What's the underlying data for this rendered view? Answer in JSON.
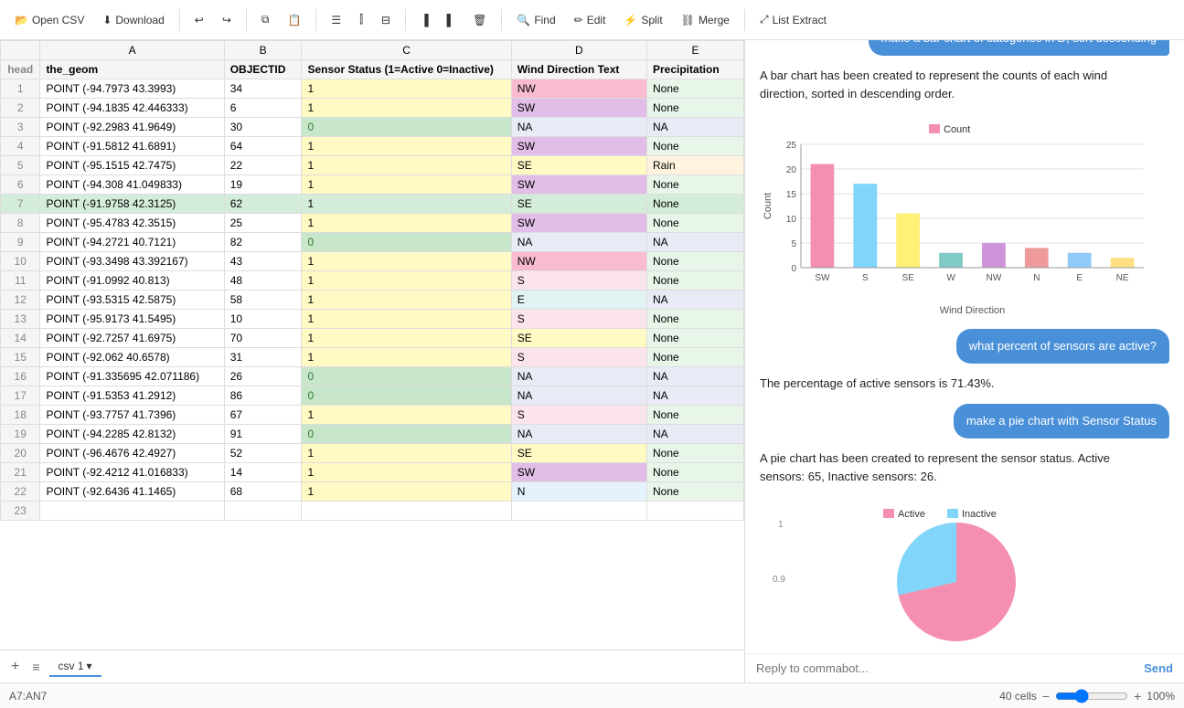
{
  "toolbar": {
    "open_csv_label": "Open CSV",
    "download_label": "Download",
    "undo_icon": "↩",
    "redo_icon": "↪",
    "copy_icon": "⧉",
    "clipboard_icon": "📋",
    "row_icon": "≡",
    "col_icon": "⫿",
    "filter_icon": "⊟",
    "freeze_left_icon": "▐",
    "freeze_right_icon": "▌",
    "delete_icon": "🗑",
    "find_label": "Find",
    "edit_label": "Edit",
    "split_label": "Split",
    "merge_label": "Merge",
    "list_extract_label": "List Extract"
  },
  "columns": [
    {
      "id": "row_num",
      "label": ""
    },
    {
      "id": "A",
      "label": "A"
    },
    {
      "id": "B",
      "label": "B"
    },
    {
      "id": "C",
      "label": "C"
    },
    {
      "id": "D",
      "label": "D"
    },
    {
      "id": "E",
      "label": "E"
    }
  ],
  "headers": {
    "head": "head",
    "col_a": "the_geom",
    "col_b": "OBJECTID",
    "col_c": "Sensor Status (1=Active 0=Inactive)",
    "col_d": "Wind Direction Text",
    "col_e": "Precipitation"
  },
  "rows": [
    {
      "num": 1,
      "a": "POINT (-94.7973 43.3993)",
      "b": "34",
      "c": "1",
      "d": "NW",
      "e": "None",
      "selected": false
    },
    {
      "num": 2,
      "a": "POINT (-94.1835 42.446333)",
      "b": "6",
      "c": "1",
      "d": "SW",
      "e": "None",
      "selected": false
    },
    {
      "num": 3,
      "a": "POINT (-92.2983 41.9649)",
      "b": "30",
      "c": "0",
      "d": "NA",
      "e": "NA",
      "selected": false
    },
    {
      "num": 4,
      "a": "POINT (-91.5812 41.6891)",
      "b": "64",
      "c": "1",
      "d": "SW",
      "e": "None",
      "selected": false
    },
    {
      "num": 5,
      "a": "POINT (-95.1515 42.7475)",
      "b": "22",
      "c": "1",
      "d": "SE",
      "e": "Rain",
      "selected": false
    },
    {
      "num": 6,
      "a": "POINT (-94.308 41.049833)",
      "b": "19",
      "c": "1",
      "d": "SW",
      "e": "None",
      "selected": false
    },
    {
      "num": 7,
      "a": "POINT (-91.9758 42.3125)",
      "b": "62",
      "c": "1",
      "d": "SE",
      "e": "None",
      "selected": true
    },
    {
      "num": 8,
      "a": "POINT (-95.4783 42.3515)",
      "b": "25",
      "c": "1",
      "d": "SW",
      "e": "None",
      "selected": false
    },
    {
      "num": 9,
      "a": "POINT (-94.2721 40.7121)",
      "b": "82",
      "c": "0",
      "d": "NA",
      "e": "NA",
      "selected": false
    },
    {
      "num": 10,
      "a": "POINT (-93.3498 43.392167)",
      "b": "43",
      "c": "1",
      "d": "NW",
      "e": "None",
      "selected": false
    },
    {
      "num": 11,
      "a": "POINT (-91.0992 40.813)",
      "b": "48",
      "c": "1",
      "d": "S",
      "e": "None",
      "selected": false
    },
    {
      "num": 12,
      "a": "POINT (-93.5315 42.5875)",
      "b": "58",
      "c": "1",
      "d": "E",
      "e": "NA",
      "selected": false
    },
    {
      "num": 13,
      "a": "POINT (-95.9173 41.5495)",
      "b": "10",
      "c": "1",
      "d": "S",
      "e": "None",
      "selected": false
    },
    {
      "num": 14,
      "a": "POINT (-92.7257 41.6975)",
      "b": "70",
      "c": "1",
      "d": "SE",
      "e": "None",
      "selected": false
    },
    {
      "num": 15,
      "a": "POINT (-92.062 40.6578)",
      "b": "31",
      "c": "1",
      "d": "S",
      "e": "None",
      "selected": false
    },
    {
      "num": 16,
      "a": "POINT (-91.335695 42.071186)",
      "b": "26",
      "c": "0",
      "d": "NA",
      "e": "NA",
      "selected": false
    },
    {
      "num": 17,
      "a": "POINT (-91.5353 41.2912)",
      "b": "86",
      "c": "0",
      "d": "NA",
      "e": "NA",
      "selected": false
    },
    {
      "num": 18,
      "a": "POINT (-93.7757 41.7396)",
      "b": "67",
      "c": "1",
      "d": "S",
      "e": "None",
      "selected": false
    },
    {
      "num": 19,
      "a": "POINT (-94.2285 42.8132)",
      "b": "91",
      "c": "0",
      "d": "NA",
      "e": "NA",
      "selected": false
    },
    {
      "num": 20,
      "a": "POINT (-96.4676 42.4927)",
      "b": "52",
      "c": "1",
      "d": "SE",
      "e": "None",
      "selected": false
    },
    {
      "num": 21,
      "a": "POINT (-92.4212 41.016833)",
      "b": "14",
      "c": "1",
      "d": "SW",
      "e": "None",
      "selected": false
    },
    {
      "num": 22,
      "a": "POINT (-92.6436 41.1465)",
      "b": "68",
      "c": "1",
      "d": "N",
      "e": "None",
      "selected": false
    },
    {
      "num": 23,
      "a": "",
      "b": "",
      "c": "",
      "d": "",
      "e": "",
      "selected": false
    }
  ],
  "tab": {
    "label": "csv 1"
  },
  "status_bar": {
    "cell_ref": "A7:AN7",
    "cells": "40 cells",
    "zoom": "100%"
  },
  "chat": {
    "messages": [
      {
        "type": "user",
        "text": "make a bar chart of categories in D, sort descending"
      },
      {
        "type": "bot",
        "text": "A bar chart has been created to represent the counts of each wind direction, sorted in descending order."
      },
      {
        "type": "user",
        "text": "what percent of sensors are active?"
      },
      {
        "type": "bot",
        "text": "The percentage of active sensors is 71.43%."
      },
      {
        "type": "user",
        "text": "make a pie chart with Sensor Status"
      },
      {
        "type": "bot",
        "text": "A pie chart has been created to represent the sensor status. Active sensors: 65, Inactive sensors: 26."
      }
    ],
    "input_placeholder": "Reply to commabot...",
    "send_label": "Send"
  },
  "bar_chart": {
    "title": "Count",
    "x_label": "Wind Direction",
    "y_label": "Count",
    "legend_label": "Count",
    "legend_color": "#f48fb1",
    "bars": [
      {
        "label": "SW",
        "value": 21,
        "color": "#f48fb1"
      },
      {
        "label": "S",
        "value": 17,
        "color": "#81d4fa"
      },
      {
        "label": "SE",
        "value": 11,
        "color": "#fff176"
      },
      {
        "label": "W",
        "value": 3,
        "color": "#80cbc4"
      },
      {
        "label": "NW",
        "value": 5,
        "color": "#ce93d8"
      },
      {
        "label": "N",
        "value": 4,
        "color": "#ef9a9a"
      },
      {
        "label": "E",
        "value": 3,
        "color": "#90caf9"
      },
      {
        "label": "NE",
        "value": 2,
        "color": "#ffe082"
      }
    ],
    "y_max": 25,
    "y_ticks": [
      0,
      5,
      10,
      15,
      20,
      25
    ]
  },
  "pie_chart": {
    "active_count": 65,
    "inactive_count": 26,
    "active_color": "#f48fb1",
    "inactive_color": "#81d4fa",
    "active_label": "Active",
    "inactive_label": "Inactive",
    "legend_y": [
      0.9,
      1.0
    ]
  }
}
